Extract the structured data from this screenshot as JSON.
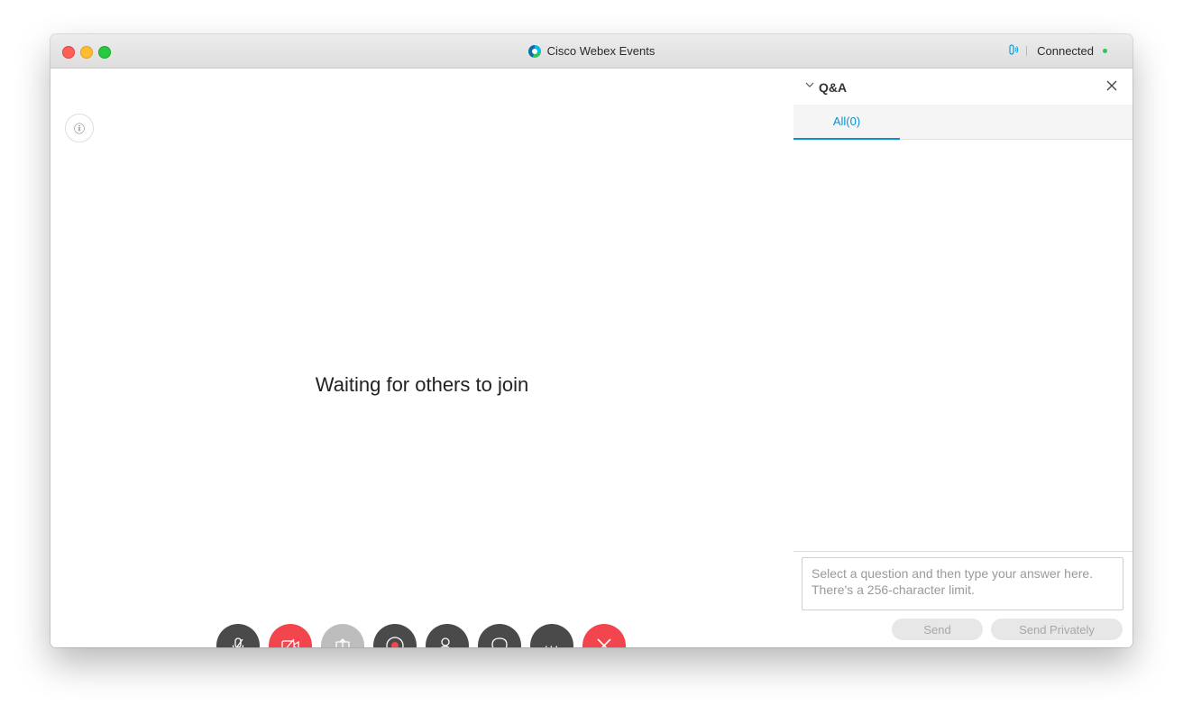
{
  "window": {
    "title": "Cisco Webex Events",
    "status": "Connected",
    "accent_color": "#0a93d0",
    "status_color": "#2dc55a"
  },
  "stage": {
    "waiting_text": "Waiting for others to join",
    "info_icon": "ⓘ"
  },
  "controls": [
    {
      "name": "mute-button",
      "icon": "microphone-muted-icon",
      "state": "muted"
    },
    {
      "name": "stop-video-button",
      "icon": "video-off-icon",
      "state": "video off"
    },
    {
      "name": "share-button",
      "icon": "share-icon",
      "state": "disabled"
    },
    {
      "name": "record-button",
      "icon": "record-icon"
    },
    {
      "name": "participants-button",
      "icon": "participants-icon"
    },
    {
      "name": "chat-button",
      "icon": "chat-icon"
    },
    {
      "name": "more-button",
      "icon": "more-icon",
      "label": "···"
    },
    {
      "name": "leave-button",
      "icon": "close-icon"
    }
  ],
  "qa_panel": {
    "title": "Q&A",
    "tabs": [
      {
        "label": "All(0)",
        "active": true
      }
    ],
    "answer_placeholder": "Select a question and then type your answer here. There's a 256-character limit.",
    "send_label": "Send",
    "send_privately_label": "Send Privately"
  }
}
